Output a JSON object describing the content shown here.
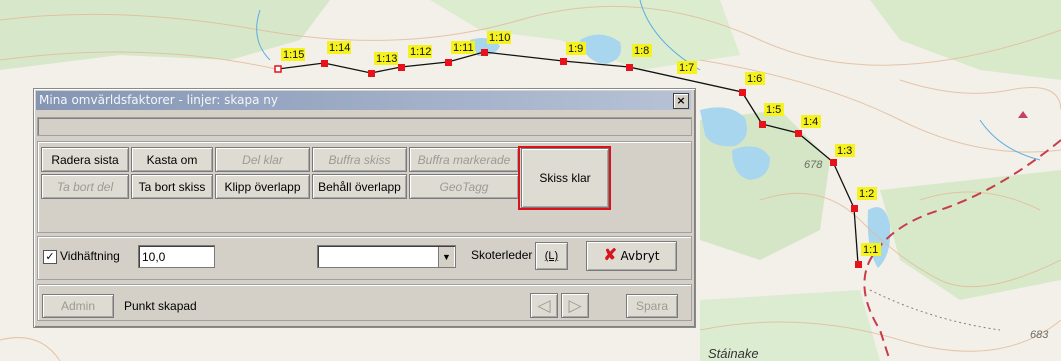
{
  "dialog": {
    "title": "Mina omvärldsfaktorer - linjer: skapa ny",
    "close": "×",
    "buttons": {
      "radera_sista": "Radera sista",
      "kasta_om": "Kasta om",
      "del_klar": "Del klar",
      "buffra_skiss": "Buffra skiss",
      "buffra_markerade": "Buffra markerade",
      "skiss_klar": "Skiss klar",
      "ta_bort_del": "Ta bort del",
      "ta_bort_skiss": "Ta bort skiss",
      "klipp_overlapp": "Klipp överlapp",
      "behall_overlapp": "Behåll överlapp",
      "geotagg": "GeoTagg"
    },
    "vidhaftning": {
      "label": "Vidhäftning",
      "checked": true,
      "check_glyph": "✓",
      "value": "10,0"
    },
    "dropdown": {
      "selected": ""
    },
    "skoterleder": {
      "label": "Skoterleder",
      "button_label": "(L)"
    },
    "avbryt": {
      "label": "Avbryt",
      "icon": "x-icon",
      "icon_glyph": "✘",
      "color": "#d7141c"
    },
    "footer": {
      "admin": "Admin",
      "status": "Punkt skapad",
      "prev_glyph": "◁",
      "next_glyph": "▷",
      "spara": "Spara"
    }
  },
  "map": {
    "labels": [
      "1:15",
      "1:14",
      "1:13",
      "1:12",
      "1:11",
      "1:10",
      "1:9",
      "1:8",
      "1:7",
      "1:6",
      "1:5",
      "1:4",
      "1:3",
      "1:2",
      "1:1"
    ],
    "elevations": [
      "678",
      "683"
    ],
    "place": "Stáinake"
  },
  "colors": {
    "label_bg": "#f5f21e",
    "vertex": "#e8121a",
    "dash_route": "#c83c4a"
  }
}
